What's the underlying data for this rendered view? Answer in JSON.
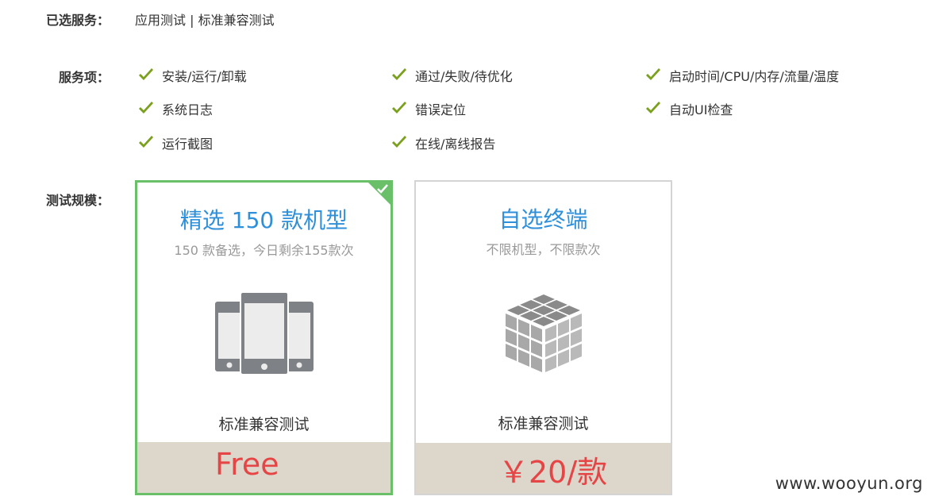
{
  "selected": {
    "label": "已选服务：",
    "value": "应用测试 | 标准兼容测试"
  },
  "services": {
    "label": "服务项：",
    "items": [
      "安装/运行/卸载",
      "通过/失败/待优化",
      "启动时间/CPU/内存/流量/温度",
      "系统日志",
      "错误定位",
      "自动UI检查",
      "运行截图",
      "在线/离线报告"
    ],
    "check_color": "#7aa01e"
  },
  "scale": {
    "label": "测试规模：",
    "cards": [
      {
        "title": "精选 150 款机型",
        "subtitle": "150 款备选，今日剩余155款次",
        "name": "标准兼容测试",
        "price": "Free",
        "selected": true,
        "icon": "phones-icon"
      },
      {
        "title": "自选终端",
        "subtitle": "不限机型，不限款次",
        "name": "标准兼容测试",
        "price": "￥20/款",
        "selected": false,
        "icon": "cube-grid-icon"
      }
    ]
  },
  "colors": {
    "accent_green": "#6abf69",
    "title_blue": "#2f8fd8",
    "price_red": "#e64545",
    "price_bg": "#ddd6cb"
  },
  "watermark": "www.wooyun.org"
}
